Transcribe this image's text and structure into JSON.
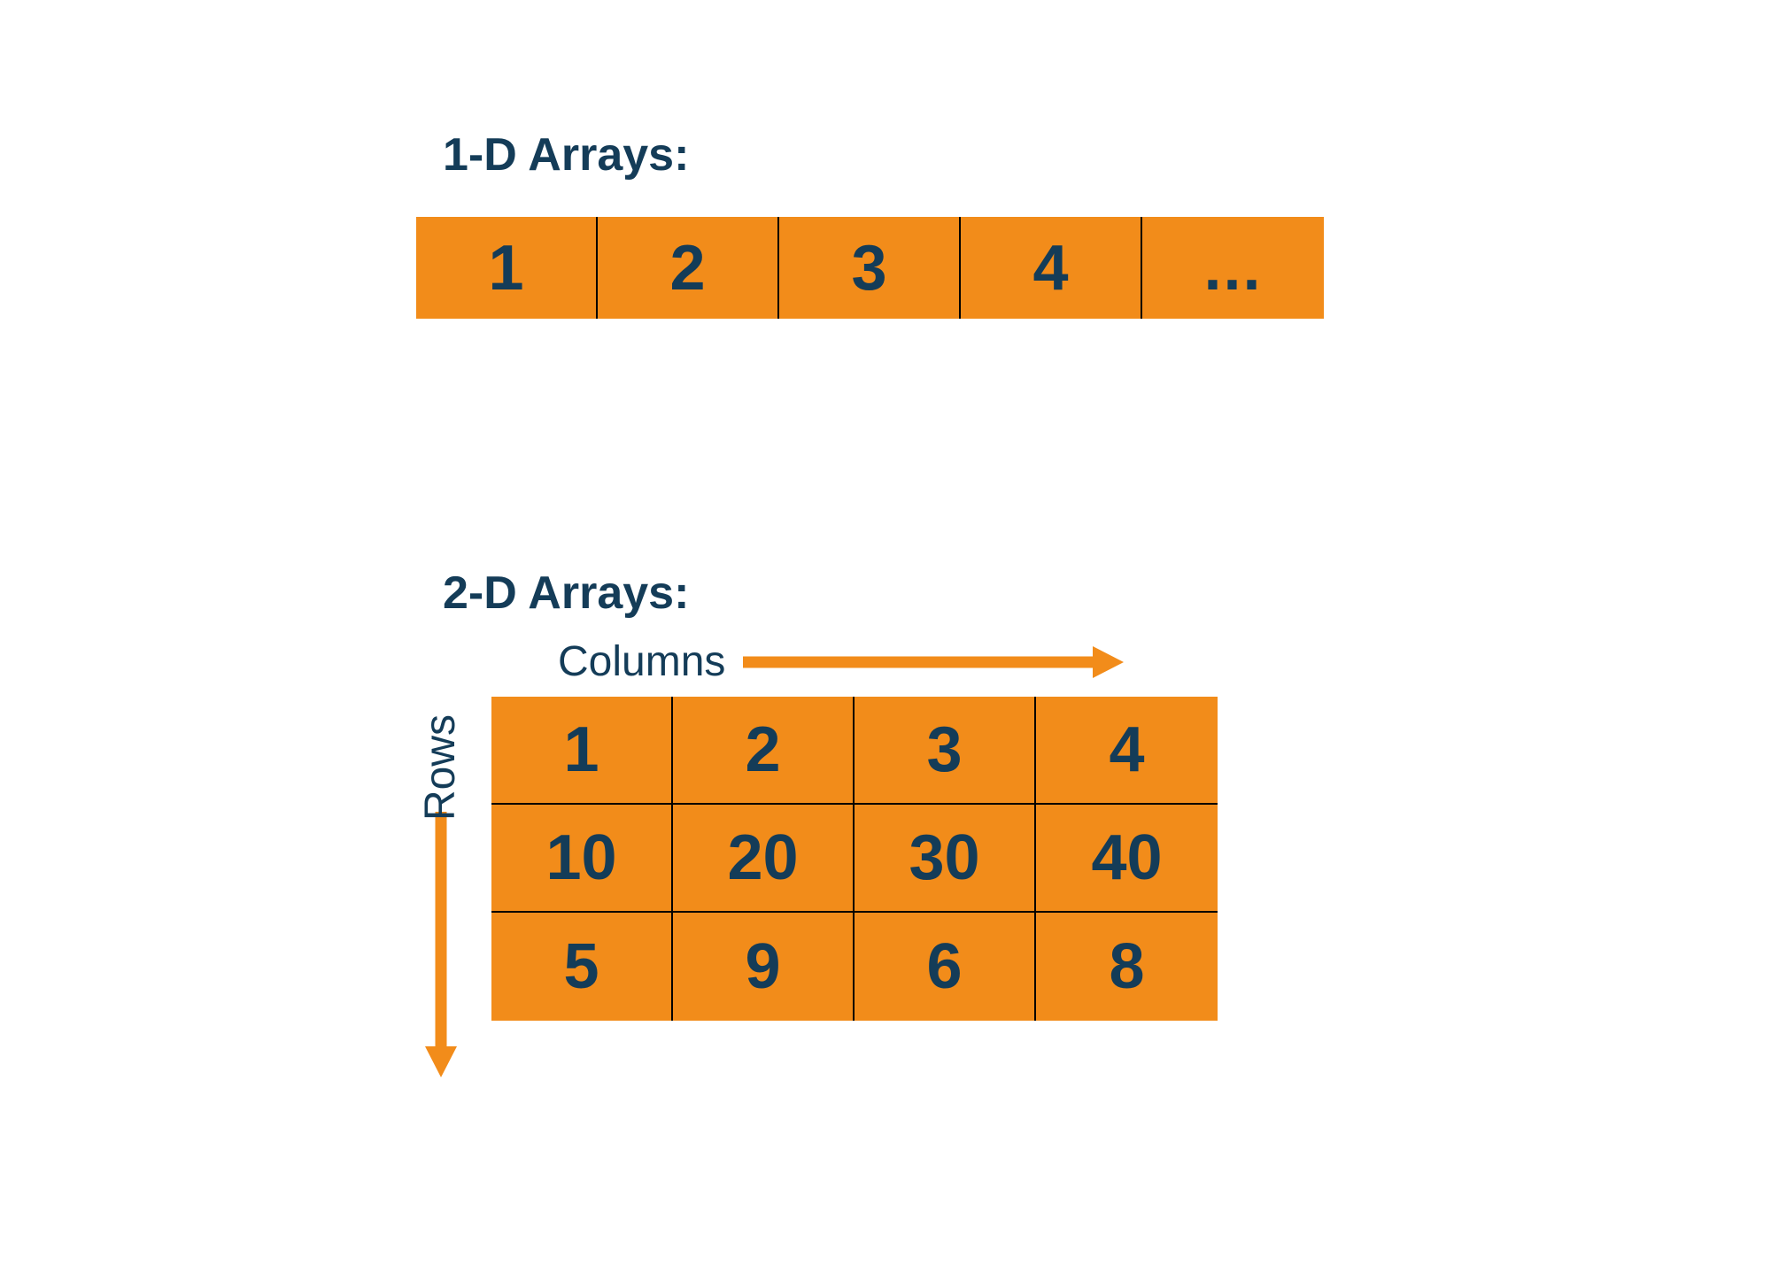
{
  "section_1d": {
    "title": "1-D Arrays:",
    "cells": [
      "1",
      "2",
      "3",
      "4",
      "..."
    ]
  },
  "section_2d": {
    "title": "2-D Arrays:",
    "columns_label": "Columns",
    "rows_label": "Rows",
    "grid": [
      [
        "1",
        "2",
        "3",
        "4"
      ],
      [
        "10",
        "20",
        "30",
        "40"
      ],
      [
        "5",
        "9",
        "6",
        "8"
      ]
    ]
  },
  "colors": {
    "cell_bg": "#f28c1a",
    "text_dark": "#143c58",
    "arrow": "#f28c1a"
  }
}
